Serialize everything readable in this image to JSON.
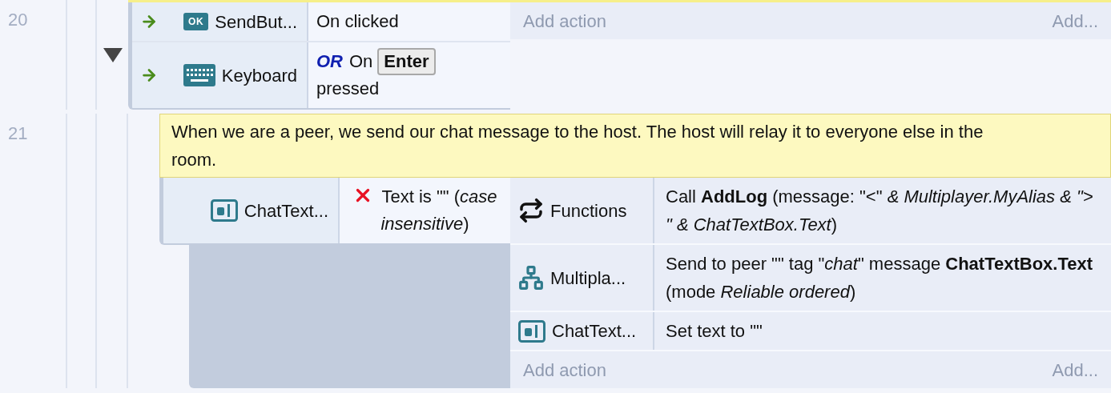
{
  "events": [
    {
      "number": "20",
      "expanded": true,
      "conditions": [
        {
          "object": "SendBut...",
          "kind": "button",
          "icon_text": "OK",
          "trigger": true,
          "inverted": false,
          "parts": [
            {
              "kind": "text",
              "text": "On clicked"
            }
          ]
        },
        {
          "object": "Keyboard",
          "kind": "keyboard",
          "trigger": true,
          "inverted": false,
          "parts": [
            {
              "kind": "or",
              "text": "OR"
            },
            {
              "kind": "text",
              "text": "On"
            },
            {
              "kind": "key",
              "text": "Enter"
            },
            {
              "kind": "text",
              "text": "pressed"
            }
          ]
        }
      ],
      "add_action": "Add action",
      "add_more": "Add...",
      "children": [
        {
          "number": "21",
          "comment": "When we are a peer, we send our chat message to the host. The host will relay it to everyone else in the room.",
          "conditions": [
            {
              "object": "ChatText...",
              "kind": "textbox",
              "trigger": false,
              "inverted": true,
              "parts": [
                {
                  "kind": "text",
                  "text": "Text is \"\" (*case insensitive*)"
                }
              ]
            }
          ],
          "actions": [
            {
              "object": "Functions",
              "kind": "functions",
              "text": "Call **AddLog** (message: \"<\" *& Multiplayer.MyAlias & \"> \" & ChatTextBox.Text*)"
            },
            {
              "object": "Multipla...",
              "kind": "multiplayer",
              "text": "Send to peer \"\" tag \"*chat*\" message **ChatTextBox.Text** (mode *Reliable ordered*)"
            },
            {
              "object": "ChatText...",
              "kind": "textbox",
              "text": "Set text to \"\""
            }
          ],
          "add_action": "Add action",
          "add_more": "Add..."
        }
      ]
    }
  ]
}
